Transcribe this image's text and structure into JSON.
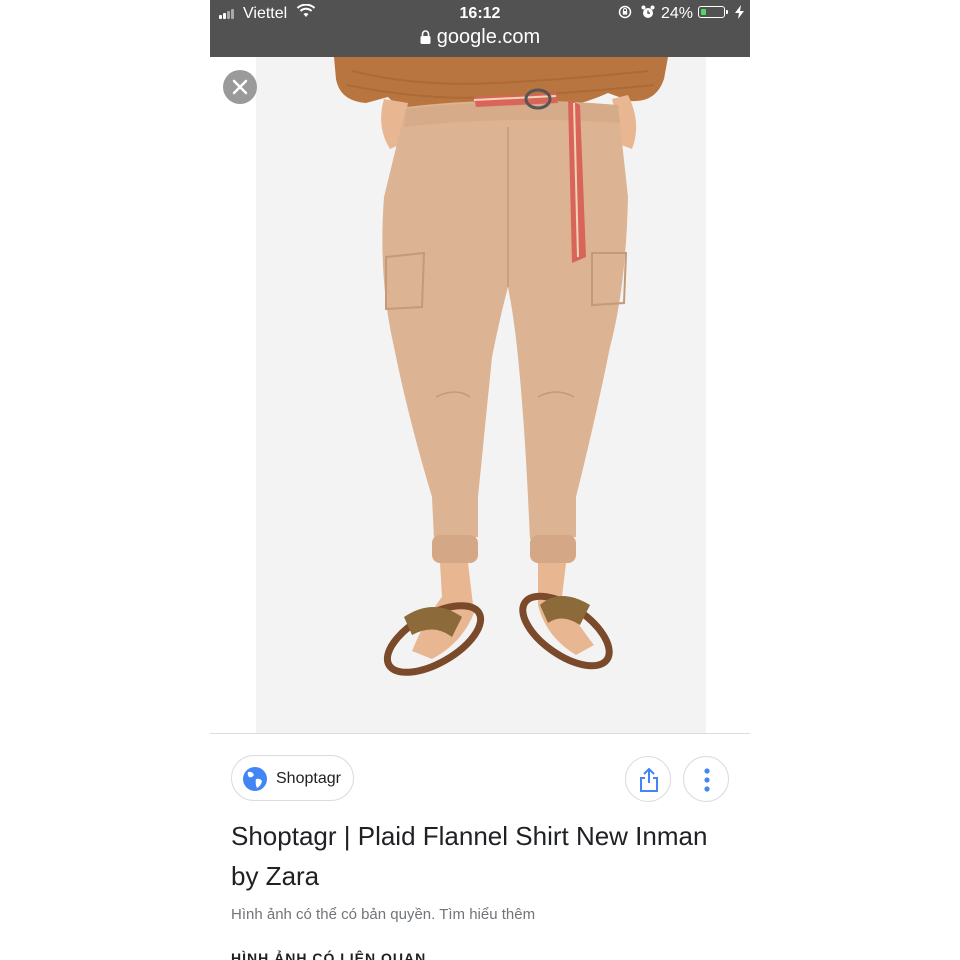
{
  "status_bar": {
    "carrier": "Viettel",
    "time": "16:12",
    "battery_percent": "24%",
    "battery_level": 0.24,
    "icons": [
      "signal-icon",
      "wifi-icon",
      "rotation-lock-icon",
      "alarm-icon",
      "battery-icon",
      "charging-icon"
    ]
  },
  "address_bar": {
    "url": "google.com",
    "icon": "lock-icon"
  },
  "viewer": {
    "close_icon": "close-icon",
    "image_subject": "beige cargo jogger pants with striped belt and snakeskin sandals"
  },
  "source": {
    "name": "Shoptagr",
    "icon": "globe-icon"
  },
  "actions": {
    "share_icon": "share-icon",
    "more_icon": "more-vert-icon"
  },
  "result": {
    "title": "Shoptagr | Plaid Flannel Shirt New Inman by Zara",
    "copyright_notice": "Hình ảnh có thể có bản quyền. Tìm hiểu thêm",
    "related_heading": "HÌNH ẢNH CÓ LIÊN QUAN"
  },
  "colors": {
    "topbar": "#525252",
    "battery_fill": "#4cd964",
    "pants": "#dcb393",
    "sweater": "#b9753f",
    "belt": "#d9655a"
  }
}
